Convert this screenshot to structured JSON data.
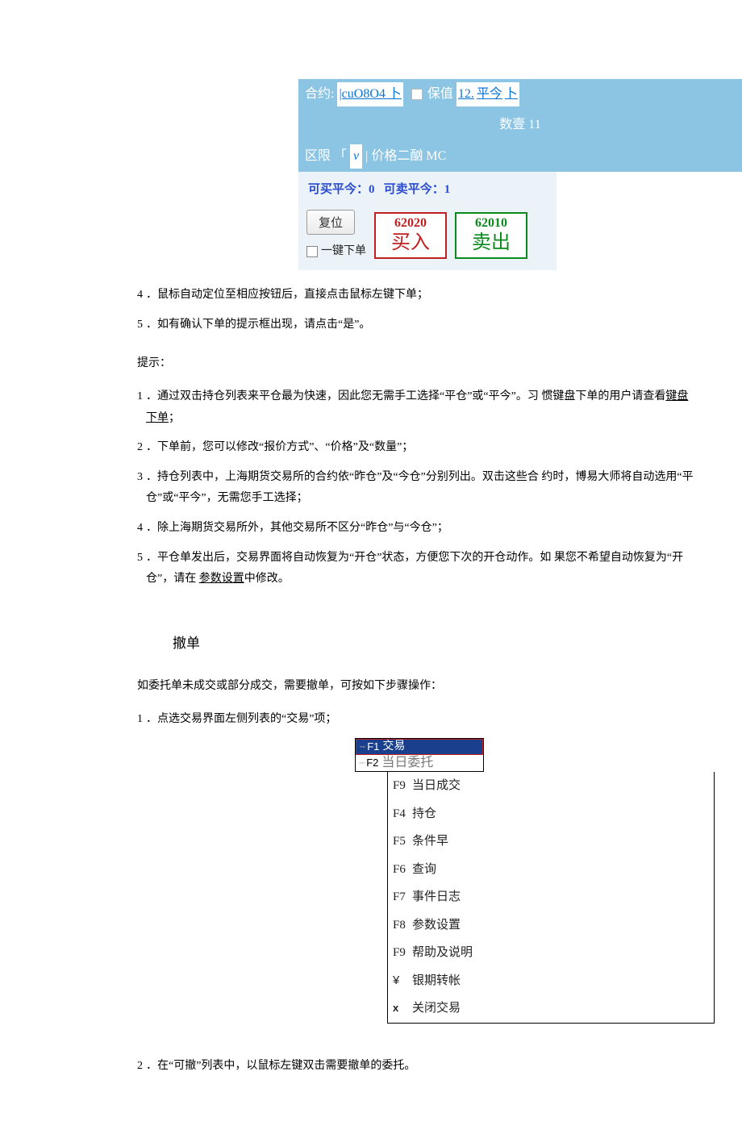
{
  "panel": {
    "contract_label": "合约:",
    "contract_value": "|cuO8O4 卜",
    "hedge_label": "保值",
    "hedge_link": "12.",
    "close_today": "平今",
    "qty_label": "数壹 11",
    "limit_label": "区限",
    "v_mark": "v",
    "price_label": "价格二酗 MC",
    "can_buy": "可买平今：0",
    "can_sell": "可卖平今：1",
    "reset": "复位",
    "one_click": "一键下单",
    "buy_price": "62020",
    "buy_label": "买入",
    "sell_price": "62010",
    "sell_label": "卖出"
  },
  "steps1": [
    {
      "n": "4",
      "t": "．鼠标自动定位至相应按钮后，直接点击鼠标左键下单；"
    },
    {
      "n": "5",
      "t": "．如有确认下单的提示框出现，请点击“是”。"
    }
  ],
  "hint_head": "提示：",
  "hints": [
    {
      "n": "1",
      "pre": "．通过双击持仓列表来平仓最为快速，因此您无需手工选择“平仓”或“平今”。习 惯键盘下单的用户请查看",
      "u": "键盘下单",
      "post": "；"
    },
    {
      "n": "2",
      "pre": "．下单前，您可以修改“报价方式”、“价格”及“数量”；",
      "u": "",
      "post": ""
    },
    {
      "n": "3",
      "pre": "．持仓列表中，上海期货交易所的合约依“昨仓”及“今仓”分别列出。双击这些合 约时，博易大师将自动选用“平仓”或“平今”，无需您手工选择；",
      "u": "",
      "post": ""
    },
    {
      "n": "4",
      "pre": "．除上海期货交易所外，其他交易所不区分“昨仓”与“今仓”；",
      "u": "",
      "post": ""
    },
    {
      "n": "5",
      "pre": "．平仓单发出后，交易界面将自动恢复为“开仓”状态，方便您下次的开仓动作。如 果您不希望自动恢复为“开仓”，请在 ",
      "u": "参数设置",
      "post": "中修改。"
    }
  ],
  "section_cancel": "撤单",
  "cancel_intro": "如委托单未成交或部分成交，需要撤单，可按如下步骤操作：",
  "cancel_step1": {
    "n": "1",
    "t": "．点选交易界面左侧列表的“交易”项；"
  },
  "menu_top": {
    "f1": "F1",
    "f1_label": "交易",
    "f2": "F2",
    "f2_label": "当日委托"
  },
  "menu_items": [
    {
      "k": "F9",
      "t": "当日成交"
    },
    {
      "k": "F4",
      "t": "持仓"
    },
    {
      "k": "F5",
      "t": "条件早"
    },
    {
      "k": "F6",
      "t": "查询"
    },
    {
      "k": "F7",
      "t": "事件日志"
    },
    {
      "k": "F8",
      "t": "参数设置"
    },
    {
      "k": "F9",
      "t": "帮助及说明"
    },
    {
      "k": "¥",
      "t": "银期转帐"
    },
    {
      "k": "x",
      "t": "关闭交易"
    }
  ],
  "cancel_step2": {
    "n": "2",
    "t": "．在“可撤”列表中，以鼠标左键双击需要撤单的委托。"
  }
}
